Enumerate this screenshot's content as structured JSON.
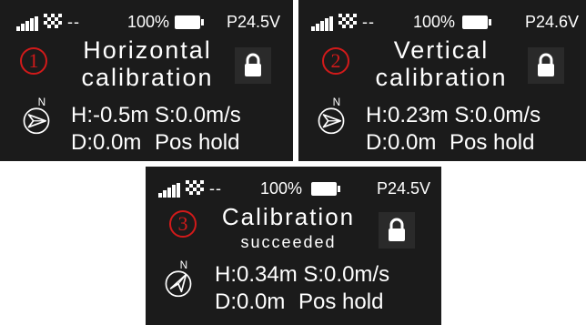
{
  "panel1": {
    "status": {
      "gps_dashes": "--",
      "battery_pct": "100%",
      "voltage": "P24.5V"
    },
    "step_number": "1",
    "title_line1": "Horizontal",
    "title_line2": "calibration",
    "height": "H:-0.5m",
    "speed": "S:0.0m/s",
    "distance": "D:0.0m",
    "mode": "Pos hold",
    "compass_letter": "N"
  },
  "panel2": {
    "status": {
      "gps_dashes": "--",
      "battery_pct": "100%",
      "voltage": "P24.6V"
    },
    "step_number": "2",
    "title_line1": "Vertical",
    "title_line2": "calibration",
    "height": "H:0.23m",
    "speed": "S:0.0m/s",
    "distance": "D:0.0m",
    "mode": "Pos hold",
    "compass_letter": "N"
  },
  "panel3": {
    "status": {
      "gps_dashes": "--",
      "battery_pct": "100%",
      "voltage": "P24.5V"
    },
    "step_number": "3",
    "title_line1": "Calibration",
    "title_line2": "succeeded",
    "height": "H:0.34m",
    "speed": "S:0.0m/s",
    "distance": "D:0.0m",
    "mode": "Pos hold",
    "compass_letter": "N"
  },
  "colors": {
    "screen_bg": "#1b1b1b",
    "text": "#ffffff",
    "step_number": "#d11a1a"
  },
  "icons": [
    "signal-icon",
    "gps-icon",
    "battery-icon",
    "lock-icon",
    "compass-icon"
  ]
}
